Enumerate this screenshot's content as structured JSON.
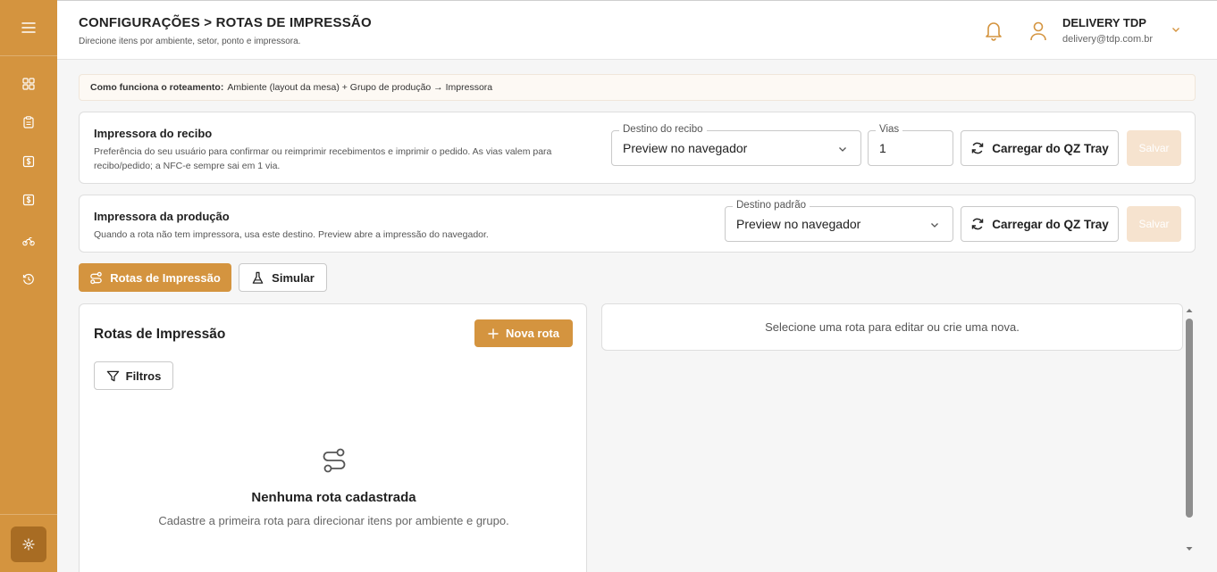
{
  "header": {
    "title": "CONFIGURAÇÕES > ROTAS DE IMPRESSÃO",
    "subtitle": "Direcione itens por ambiente, setor, ponto e impressora.",
    "user_name": "DELIVERY TDP",
    "user_email": "delivery@tdp.com.br"
  },
  "info_bar": {
    "label": "Como funciona o roteamento:",
    "text": "Ambiente (layout da mesa) + Grupo de produção → Impressora"
  },
  "receipt_printer": {
    "title": "Impressora do recibo",
    "description": "Preferência do seu usuário para confirmar ou reimprimir recebimentos e imprimir o pedido. As vias valem para recibo/pedido; a NFC-e sempre sai em 1 via.",
    "destination_label": "Destino do recibo",
    "destination_value": "Preview no navegador",
    "copies_label": "Vias",
    "copies_value": "1",
    "load_button": "Carregar do QZ Tray",
    "save_button": "Salvar"
  },
  "production_printer": {
    "title": "Impressora da produção",
    "description": "Quando a rota não tem impressora, usa este destino. Preview abre a impressão do navegador.",
    "destination_label": "Destino padrão",
    "destination_value": "Preview no navegador",
    "load_button": "Carregar do QZ Tray",
    "save_button": "Salvar"
  },
  "tabs": [
    {
      "label": "Rotas de Impressão",
      "active": true
    },
    {
      "label": "Simular",
      "active": false
    }
  ],
  "routes": {
    "title": "Rotas de Impressão",
    "new_button": "Nova rota",
    "filter_button": "Filtros",
    "empty_title": "Nenhuma rota cadastrada",
    "empty_desc": "Cadastre a primeira rota para direcionar itens por ambiente e grupo."
  },
  "editor": {
    "placeholder": "Selecione uma rota para editar ou crie uma nova."
  },
  "colors": {
    "accent": "#d4943f",
    "accent_dark": "#a86c23",
    "disabled": "#f6e3cf"
  }
}
